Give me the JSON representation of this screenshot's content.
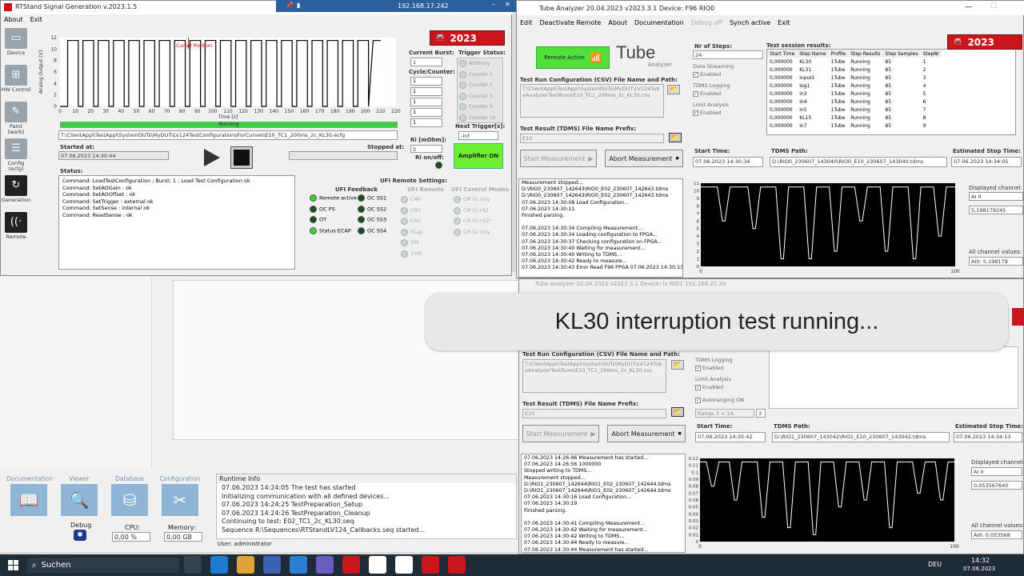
{
  "colors": {
    "red": "#c9151b",
    "green": "#39d13a",
    "ampgreen": "#6cf02d"
  },
  "rdp": {
    "ip": "192.168.17.242"
  },
  "sig": {
    "title": "RTStand Signal Generation v.2023.1.5",
    "menu": [
      "About",
      "Exit"
    ],
    "sidebar": [
      {
        "label": "Device",
        "icon": "device-icon"
      },
      {
        "label": "HW Control",
        "icon": "hw-control-icon"
      },
      {
        "label": "Paint (warb)",
        "icon": "paint-icon"
      },
      {
        "label": "Config (ecfg)",
        "icon": "config-icon"
      },
      {
        "label": "Generation",
        "icon": "generation-icon"
      },
      {
        "label": "Remote",
        "icon": "remote-icon"
      }
    ],
    "chart_data": {
      "type": "line",
      "title": "",
      "xlabel": "Time [s]",
      "ylabel": "Analog Output [V]",
      "xlim": [
        0,
        220
      ],
      "ylim": [
        0,
        12
      ],
      "xticks": [
        0,
        10,
        20,
        30,
        40,
        50,
        60,
        70,
        80,
        90,
        100,
        110,
        120,
        130,
        140,
        150,
        160,
        170,
        180,
        190,
        200,
        210,
        220
      ],
      "yticks": [
        0,
        2,
        4,
        6,
        8,
        10,
        12
      ],
      "pulses": {
        "high": 11.5,
        "low": 0,
        "period": 10,
        "count": 20,
        "start": 5,
        "off_width": 3
      },
      "annotation": "Cursor Position"
    },
    "running_label": "Running",
    "progress": 1,
    "config_path": "T:\\ClientAppl\\TestAppl\\SystemDUTs\\MyDUT\\LV124TestConfigurationsForCurves\\E10_TC1_200ms_2c_KL30.ecfg",
    "started_label": "Started at:",
    "started_value": "07.06.2023 14:30:44",
    "stopped_label": "Stopped at:",
    "stopped_value": "",
    "status_label": "Status:",
    "status_lines": [
      "Command: LoadTestConfiguration ; Burst: 1 ; Load Test Configuration ok",
      "Command: SetAOGain :  ok",
      "Command: SetAOOffset :  ok",
      "Command: SetTrigger : external ok",
      "Command: SetSense : internal ok",
      "Command: ReadSense :  ok"
    ],
    "current_burst_label": "Current Burst:",
    "current_burst": "1",
    "cycle_label": "Cycle/Counter:",
    "cycles": [
      "1",
      "1",
      "1",
      "1",
      "1"
    ],
    "trigger_status_label": "Trigger Status:",
    "triggers": [
      "Arbitrary",
      "Counter 1",
      "Counter 2",
      "Counter 3",
      "Counter 4",
      "Counter 1b"
    ],
    "next_trigger_label": "Next Trigger[s]:",
    "next_trigger": "-Inf",
    "ri_label": "Ri [mOhm]:",
    "ri_value": "0",
    "ri_onoff_label": "Ri on/off:",
    "amp_label": "Amplifier ON",
    "year": "2023",
    "ufi_settings_label": "UFI Remote Settings:",
    "ufi_feedback_label": "UFI Feedback",
    "ufi_feedback": [
      {
        "a": "Remote active",
        "b": "OC SS1"
      },
      {
        "a": "OC PS",
        "b": "OC SS2"
      },
      {
        "a": "OT",
        "b": "OC SS3"
      },
      {
        "a": "Status ECAP",
        "b": "OC SS4"
      }
    ],
    "ufi_remote_label": "UFI Remote",
    "ufi_remote": [
      "CM0",
      "CM1",
      "CM2",
      "ECap",
      "10k",
      "100k"
    ],
    "ufi_modes_label": "UFI Control Modes",
    "ufi_modes": [
      "CM S1 only",
      "CM S1+S2",
      "CM S1+S2*",
      "CM S2 only"
    ]
  },
  "ta1": {
    "title": "Tube Analyzer 20.04.2023 v2023.3.1 Device: F96 RIO0",
    "menu": [
      "Edit",
      "Deactivate Remote",
      "About",
      "Documentation",
      "Debug off",
      "Synch active",
      "Exit"
    ],
    "remote_active": "Remote Active",
    "logo": "Tube",
    "logo_sub": "Analyzer",
    "nr_steps_label": "Nr of Steps:",
    "nr_steps": "24",
    "data_streaming_label": "Data Streaming",
    "tdms_logging_label": "TDMS Logging",
    "limit_analysis_label": "Limit Analysis",
    "enabled": "Enabled",
    "csv_label": "Test Run Configuration (CSV) File Name and Path:",
    "csv_value": "T:\\ClientAppl\\TestAppl\\SystemDUTs\\MyDUT\\LV124TubeAnalyzerTestRuns\\E10_TC1_200ms_2c_KL30.csv",
    "tdms_prefix_label": "Test Result (TDMS) File Name Prefix:",
    "tdms_prefix": "E10",
    "start_btn": "Start Measurement",
    "abort_btn": "Abort Measurement",
    "results_label": "Test session results:",
    "results_headers": [
      "Start Time",
      "Step Name",
      "Profile",
      "Step Results",
      "Step Samples",
      "StepNr"
    ],
    "results_rows": [
      [
        "0,000000",
        "KL30",
        "1Tube",
        "Running",
        "85",
        "1"
      ],
      [
        "0,000000",
        "KL31",
        "1Tube",
        "Running",
        "85",
        "2"
      ],
      [
        "0,000000",
        "input1",
        "1Tube",
        "Running",
        "85",
        "3"
      ],
      [
        "0,000000",
        "log1",
        "1Tube",
        "Running",
        "85",
        "4"
      ],
      [
        "0,000000",
        "in3",
        "1Tube",
        "Running",
        "85",
        "5"
      ],
      [
        "0,000000",
        "in4",
        "1Tube",
        "Running",
        "85",
        "6"
      ],
      [
        "0,000000",
        "in5",
        "1Tube",
        "Running",
        "85",
        "7"
      ],
      [
        "0,000000",
        "KL15",
        "1Tube",
        "Running",
        "85",
        "8"
      ],
      [
        "0,000000",
        "in7",
        "1Tube",
        "Running",
        "85",
        "9"
      ]
    ],
    "start_time_label": "Start Time:",
    "start_time": "07.06.2023 14:30:34",
    "tdms_path_label": "TDMS Path:",
    "tdms_path": "D:\\RIO0_230607_143040\\RIO0_E10_230607_143040.tdms",
    "est_stop_label": "Estimated Stop Time:",
    "est_stop": "07.06.2023 14:34:05",
    "log": [
      "Measurement stopped...",
      "D:\\RIO0_230607_142643\\RIO0_E02_230607_142643.tdms",
      "D:\\RIO0_230607_142643\\RIO0_E02_230607_142643.tdms",
      "07.06.2023 14:30:08 Load Configuration...",
      "07.06.2023 14:30:11",
      "Finished parsing.",
      "",
      "07.06.2023 14:30:34 Compiling Measurement...",
      "07.06.2023 14:30:34 Loading configuration to FPGA...",
      "07.06.2023 14:30:37 Checking configuration on FPGA...",
      "07.06.2023 14:30:40 Waiting for measurement...",
      "07.06.2023 14:30:40 Writing to TDMS...",
      "07.06.2023 14:30:42 Ready to measure...",
      "07.06.2023 14:30:43 Error Read F96 FPGA  07.06.2023 14:30:13 Inv"
    ],
    "chart_data": {
      "type": "line",
      "ylim": [
        0,
        11
      ],
      "xlim": [
        0,
        100
      ],
      "yticks": [
        0,
        1,
        2,
        3,
        4,
        5,
        6,
        7,
        8,
        9,
        10,
        11
      ],
      "xticks": [
        0,
        100
      ],
      "high": 10.5,
      "dips": [
        {
          "x": 9,
          "y": 6
        },
        {
          "x": 21,
          "y": 5
        },
        {
          "x": 32,
          "y": 1
        },
        {
          "x": 43,
          "y": 1
        },
        {
          "x": 53,
          "y": 2
        },
        {
          "x": 63,
          "y": 6
        },
        {
          "x": 73,
          "y": 2
        },
        {
          "x": 84,
          "y": 1
        },
        {
          "x": 94,
          "y": 4
        }
      ]
    },
    "displayed_channel_label": "Displayed channel:",
    "displayed_channel": "AI 0",
    "channel_value": "5,198179245",
    "all_values_label": "All channel values:",
    "all_values": "AI0: 5,198179",
    "year": "2023"
  },
  "ta2": {
    "title": "Tube Analyzer 20.04.2023 v2023.3.1 Device: lx RIO1  192.168.25.20",
    "banner": "KL30 interruption test running...",
    "csv_label": "Test Run Configuration (CSV) File Name and Path:",
    "csv_value": "T:\\ClientAppl\\TestAppl\\SystemDUTs\\MyDUT\\LV124TubeAnalyzerTestRuns\\E10_TC1_200ms_2c_KL30.csv",
    "tdms_logging_label": "TDMS Logging",
    "limit_analysis_label": "Limit Analysis",
    "enabled": "Enabled",
    "autoranging": "Autoranging ON",
    "range": "Range 3 = 1A",
    "range_num": "3",
    "tdms_prefix_label": "Test Result (TDMS) File Name Prefix:",
    "tdms_prefix": "E10",
    "start_btn": "Start Measurement",
    "abort_btn": "Abort Measurement",
    "start_time_label": "Start Time:",
    "start_time": "07.06.2023 14:30:42",
    "tdms_path_label": "TDMS Path:",
    "tdms_path": "D:\\RIO1_230607_143042\\RIO1_E10_230607_143042.tdms",
    "est_stop_label": "Estimated Stop Time:",
    "est_stop": "07.06.2023 14:34:13",
    "log": [
      "07.06.2023 14:26:46 Measurement has started...",
      "07.06.2023 14:26:56 1000000",
      "Stopped writing to TDMS...",
      "Measurement stopped...",
      "D:\\RIO1_230607_142644\\RIO1_E02_230607_142644.tdms",
      "D:\\RIO1_230607_142644\\RIO1_E02_230607_142644.tdms",
      "07.06.2023 14:30:16 Load Configuration...",
      "07.06.2023 14:30:19",
      "Finished parsing.",
      "",
      "07.06.2023 14:30:41 Compiling Measurement...",
      "07.06.2023 14:30:42 Waiting for measurement...",
      "07.06.2023 14:30:42 Writing to TDMS...",
      "07.06.2023 14:30:44 Ready to measure...",
      "07.06.2023 14:30:44 Measurement has started..."
    ],
    "chart_data": {
      "type": "line",
      "ylim": [
        0,
        0.12
      ],
      "xlim": [
        0,
        100
      ],
      "yticks": [
        0,
        0.01,
        0.02,
        0.03,
        0.04,
        0.05,
        0.06,
        0.07,
        0.08,
        0.09,
        0.1,
        0.11,
        0.12
      ],
      "ytick_labels": [
        "0",
        "0.01",
        "0.02",
        "0.03",
        "0.04",
        "0.05",
        "0.06",
        "0.07",
        "0.08",
        "0.09",
        "0.1",
        "0.11",
        "0.12"
      ],
      "xticks": [
        0,
        100
      ],
      "high": 0.115,
      "dips": [
        {
          "x": 5,
          "y": 0.08
        },
        {
          "x": 14,
          "y": 0.06
        },
        {
          "x": 25,
          "y": 0.035
        },
        {
          "x": 35,
          "y": 0.02
        },
        {
          "x": 45,
          "y": 0.01
        },
        {
          "x": 55,
          "y": 0.05
        },
        {
          "x": 65,
          "y": 0.06
        },
        {
          "x": 75,
          "y": 0.02
        },
        {
          "x": 86,
          "y": 0.07
        },
        {
          "x": 95,
          "y": 0.06
        }
      ]
    },
    "displayed_channel_label": "Displayed channel:",
    "displayed_channel": "AI 0",
    "channel_value": "0,053567640",
    "all_values_label": "All channel values:",
    "all_values": "AI0: 0,053568"
  },
  "seq": {
    "tiles": [
      {
        "label": "Documentation",
        "icon": "book-icon"
      },
      {
        "label": "Viewer",
        "icon": "magnifier-icon"
      },
      {
        "label": "Database",
        "icon": "database-icon"
      },
      {
        "label": "Configuration",
        "icon": "tools-icon"
      }
    ],
    "debug": "Debug",
    "cpu_label": "CPU:",
    "cpu": "0,00 %",
    "mem_label": "Memory:",
    "mem": "0,00 GB",
    "runtime_label": "Runtime Info",
    "runtime_lines": [
      "07.06.2023 14:24:05 The test has started",
      "Initializing communication with all defined devices...",
      "07.06.2023 14:24:25 TestPreparation_Setup",
      "07.06.2023 14:24:26 TestPreparation_Cleanup",
      "Continuing to test: E02_TC1_2c_KL30.seq",
      "Sequence R:\\Sequences\\RTStandLV124_Callbacks.seq started..."
    ],
    "user": "User: administrator"
  },
  "taskbar": {
    "search": "Suchen",
    "lang": "DEU",
    "time": "14:32",
    "date": "07.06.2023"
  }
}
